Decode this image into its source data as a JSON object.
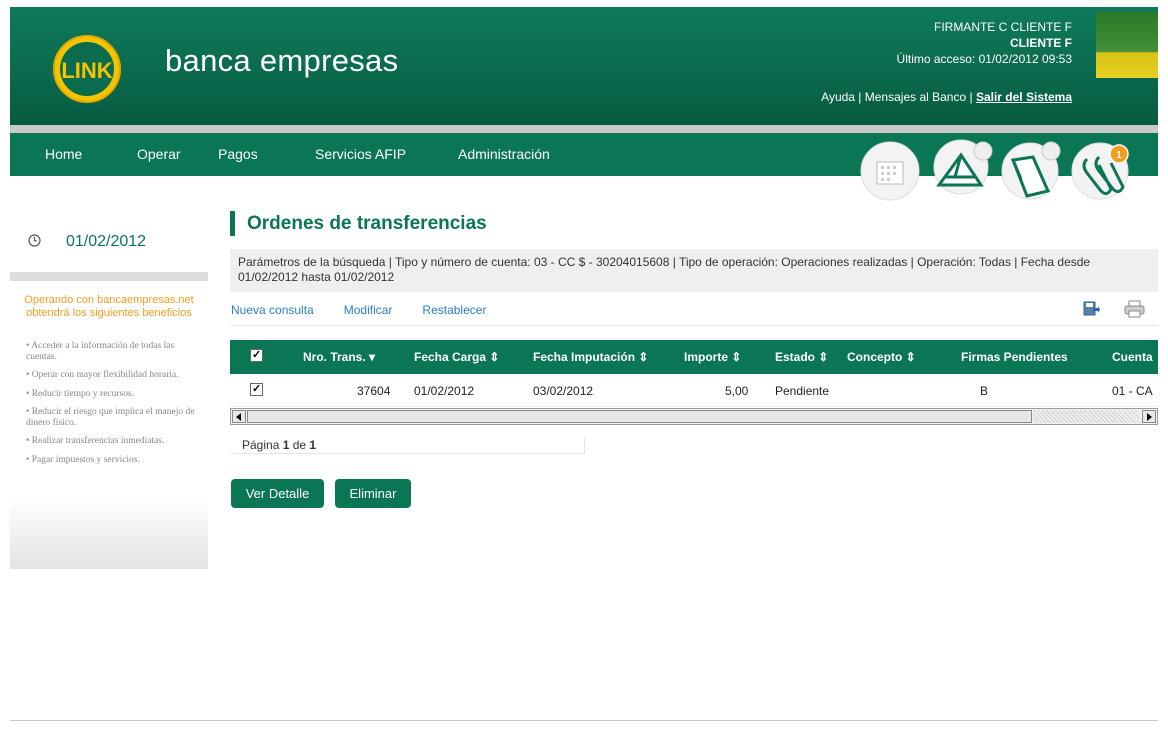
{
  "header": {
    "brand": "banca empresas",
    "logo_text": "LINK",
    "user_line1": "FIRMANTE C CLIENTE F",
    "user_line2": "CLIENTE F",
    "last_access": "Último acceso: 01/02/2012 09:53",
    "help_label": "Ayuda",
    "separator": " | ",
    "messages_label": "Mensajes al Banco",
    "logout_label": "Salir del Sistema"
  },
  "nav": {
    "items": [
      {
        "label": "Home"
      },
      {
        "label": "Operar"
      },
      {
        "label": "Pagos"
      },
      {
        "label": "Servicios AFIP"
      },
      {
        "label": "Administración"
      }
    ],
    "icons": [
      "calendar-icon",
      "envelope-icon",
      "folder-icon",
      "paperclip-icon"
    ],
    "notification_count": "1"
  },
  "sidebar": {
    "date": "01/02/2012",
    "benefits_title_1": "Operando con bancaempresas.net",
    "benefits_title_2": "obtendrá los siguientes beneficios",
    "benefits": [
      "Acceder a la información de todas las cuentas.",
      "Operar con mayor flexibilidad horaria.",
      "Reducir tiempo y recursos.",
      "Reducir el riesgo que implica el manejo de dinero físico.",
      "Realizar transferencias inmediatas.",
      "Pagar impuestos y servicios."
    ]
  },
  "main": {
    "title": "Ordenes de transferencias",
    "params": "Parámetros de la búsqueda   | Tipo y número de cuenta: 03 - CC $ - 30204015608 | Tipo de operación: Operaciones realizadas | Operación: Todas | Fecha desde 01/02/2012 hasta 01/02/2012",
    "actions": {
      "new_query": "Nueva consulta",
      "modify": "Modificar",
      "reset": "Restablecer"
    },
    "table": {
      "columns": [
        "Nro. Trans. ▾",
        "Fecha Carga ⇕",
        "Fecha Imputación ⇕",
        "Importe ⇕",
        "Estado ⇕",
        "Concepto ⇕",
        "Firmas Pendientes",
        "Cuenta"
      ],
      "rows": [
        {
          "nro": "37604",
          "fecha_carga": "01/02/2012",
          "fecha_imputacion": "03/02/2012",
          "importe": "5,00",
          "estado": "Pendiente",
          "concepto": "",
          "firmas": "B",
          "cuenta": "01 - CA"
        }
      ]
    },
    "pager": {
      "prefix": "Página ",
      "current": "1",
      "middle": " de ",
      "total": "1"
    },
    "buttons": {
      "detail": "Ver Detalle",
      "delete": "Eliminar"
    }
  },
  "colors": {
    "brand_green": "#0a7656",
    "accent_orange": "#f39c1f",
    "link_blue": "#2c7fbf"
  }
}
